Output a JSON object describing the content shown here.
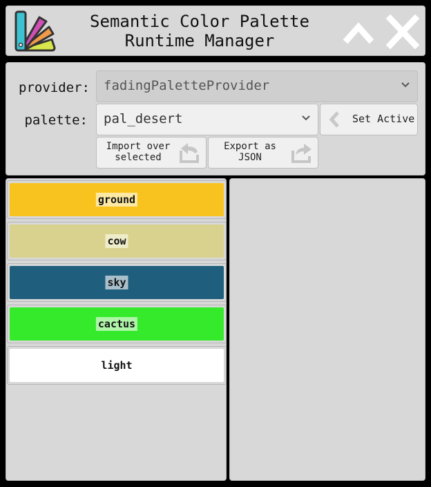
{
  "window": {
    "title_line1": "Semantic Color Palette",
    "title_line2": "Runtime Manager",
    "icons": {
      "app": "palette-fan-icon",
      "collapse": "chevron-up-icon",
      "close": "close-icon"
    }
  },
  "controls": {
    "provider_label": "provider:",
    "provider_value": "fadingPaletteProvider",
    "palette_label": "palette:",
    "palette_value": "pal_desert",
    "set_active_label": "Set Active",
    "import_line1": "Import over",
    "import_line2": "selected",
    "export_line1": "Export as",
    "export_line2": "JSON"
  },
  "colors": [
    {
      "name": "ground",
      "color": "#f9c31f",
      "label_bg": "#fde9a3"
    },
    {
      "name": "cow",
      "color": "#d9d28f",
      "label_bg": "#efecc9"
    },
    {
      "name": "sky",
      "color": "#1f5f7d",
      "label_bg": "#a9c0cc"
    },
    {
      "name": "cactus",
      "color": "#35ea2b",
      "label_bg": "#aef5a8"
    },
    {
      "name": "light",
      "color": "#ffffff",
      "label_bg": "#ffffff"
    }
  ],
  "theme": {
    "panel_bg": "#d8d8d8",
    "window_bg": "#000000",
    "button_bg": "#f0f0f0"
  }
}
